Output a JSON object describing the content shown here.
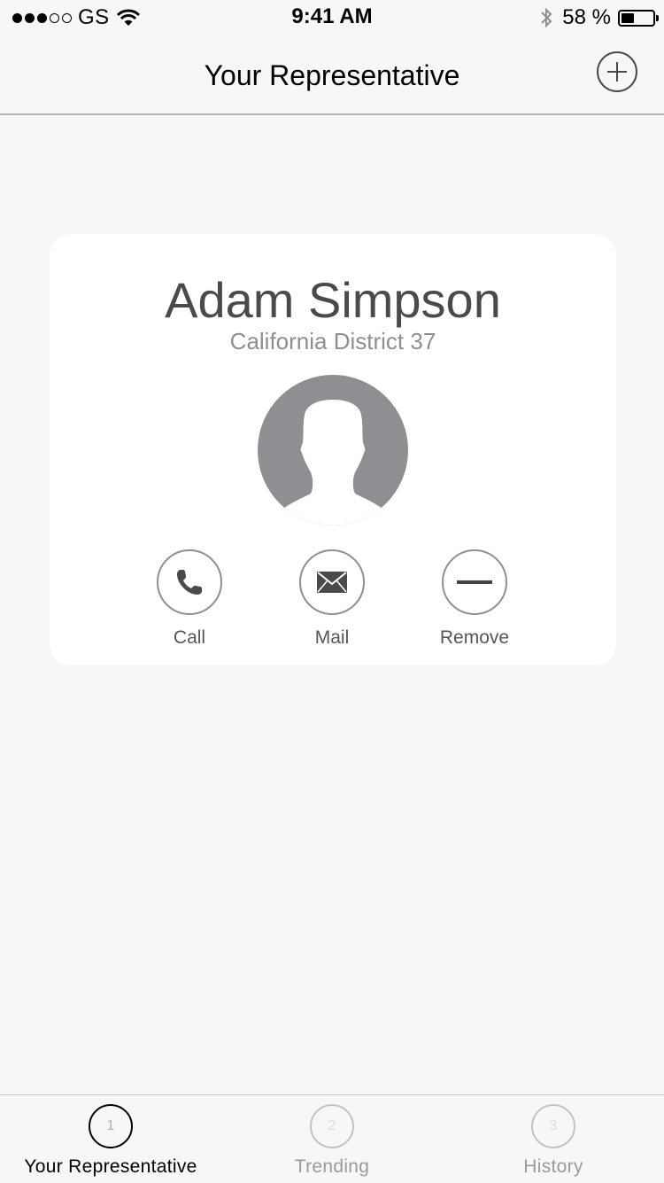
{
  "status_bar": {
    "signal_dots": [
      "on",
      "on",
      "on",
      "off",
      "off"
    ],
    "carrier": "GS",
    "wifi_icon": "wifi-icon",
    "time": "9:41 AM",
    "bluetooth_icon": "bluetooth-icon",
    "battery_percent": "58 %",
    "battery_level": 0.4
  },
  "nav": {
    "title": "Your Representative",
    "add_icon": "plus-circle-icon"
  },
  "representative": {
    "name": "Adam Simpson",
    "district": "California District 37",
    "avatar_icon": "person-silhouette-icon"
  },
  "actions": [
    {
      "label": "Call",
      "icon": "phone-icon"
    },
    {
      "label": "Mail",
      "icon": "envelope-icon"
    },
    {
      "label": "Remove",
      "icon": "minus-icon"
    }
  ],
  "tabs": [
    {
      "number": "1",
      "label": "Your Representative",
      "active": true
    },
    {
      "number": "2",
      "label": "Trending",
      "active": false
    },
    {
      "number": "3",
      "label": "History",
      "active": false
    }
  ],
  "colors": {
    "background": "#f7f7f7",
    "card": "#ffffff",
    "name_text": "#4a4a4a",
    "secondary_text": "#8e8e93",
    "avatar": "#8e8e93"
  }
}
